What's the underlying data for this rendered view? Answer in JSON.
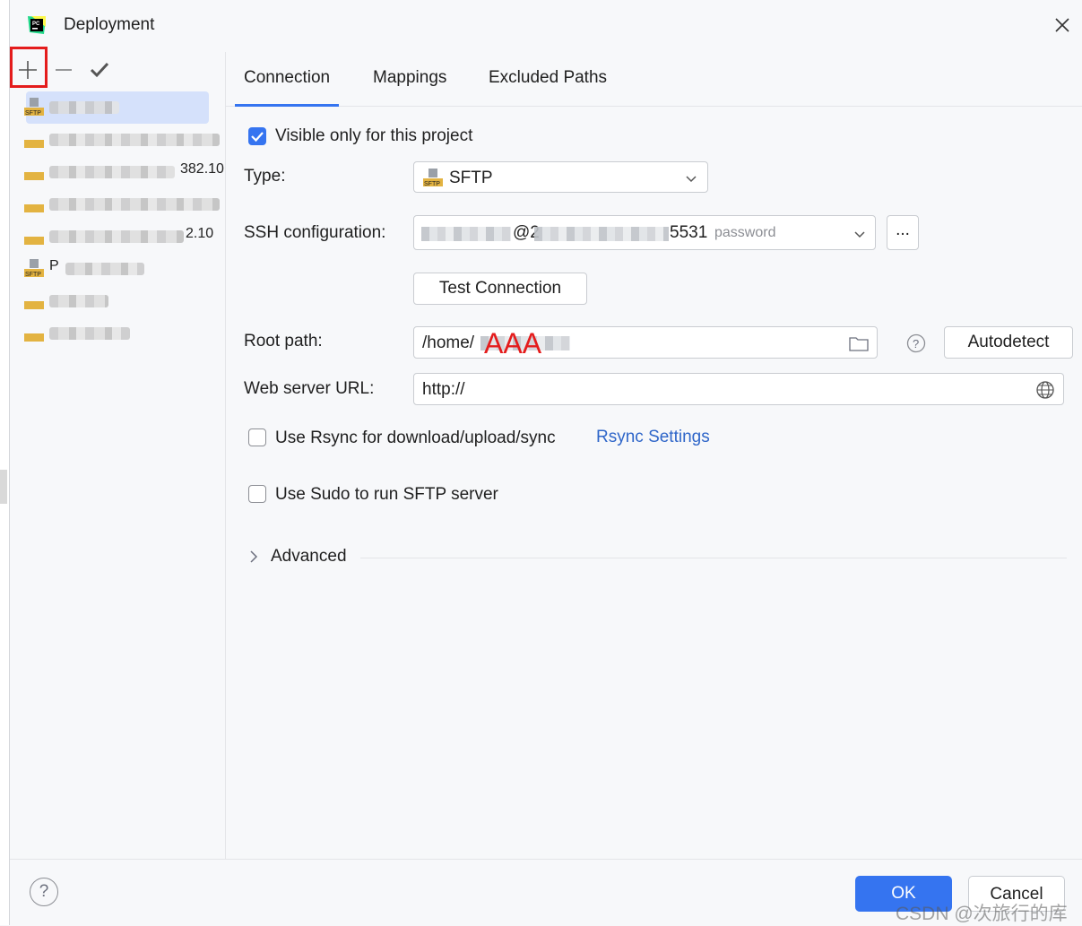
{
  "window": {
    "title": "Deployment"
  },
  "left_panel": {
    "toolbar": {
      "add": "+",
      "remove": "—",
      "apply": "✓"
    },
    "servers": [
      {
        "frag": ""
      },
      {
        "frag": ""
      },
      {
        "frag": "382.10"
      },
      {
        "frag": ""
      },
      {
        "frag": "2.10"
      },
      {
        "frag": "P"
      },
      {
        "frag": ""
      },
      {
        "frag": ""
      }
    ]
  },
  "tabs": [
    {
      "label": "Connection"
    },
    {
      "label": "Mappings"
    },
    {
      "label": "Excluded Paths"
    }
  ],
  "form": {
    "visible_only": "Visible only for this project",
    "type_label": "Type:",
    "type_value": "SFTP",
    "ssh_label": "SSH configuration:",
    "ssh_value_at": "@2",
    "ssh_value_port": "5531",
    "ssh_value_hint": "password",
    "ssh_more_button": "...",
    "test_connection": "Test Connection",
    "root_path_label": "Root path:",
    "root_path_value": "/home/",
    "root_path_annotation": "AAA",
    "autodetect": "Autodetect",
    "web_url_label": "Web server URL:",
    "web_url_value": "http://",
    "use_rsync": "Use Rsync for download/upload/sync",
    "rsync_settings": "Rsync Settings",
    "use_sudo": "Use Sudo to run SFTP server",
    "advanced": "Advanced"
  },
  "footer": {
    "help": "?",
    "ok": "OK",
    "cancel": "Cancel",
    "watermark": "CSDN @次旅行的库"
  },
  "colors": {
    "accent": "#3574f0",
    "link": "#2f66c9",
    "annotation": "#e41c1c"
  }
}
